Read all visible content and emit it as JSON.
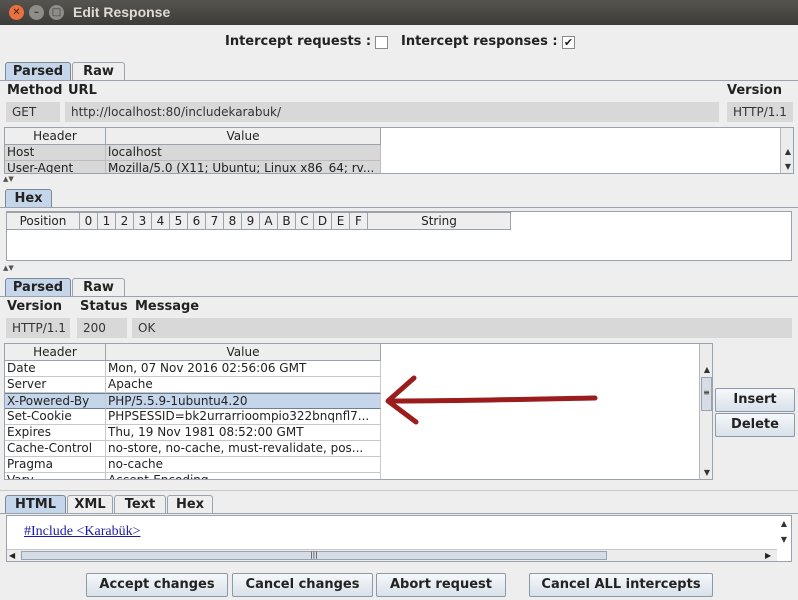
{
  "window": {
    "title": "Edit Response",
    "close": "✕",
    "minimize": "–",
    "maximize": "□"
  },
  "intercept": {
    "requests_label": "Intercept requests :",
    "requests_checked": false,
    "responses_label": "Intercept responses :",
    "responses_checked": true,
    "check_glyph": "✔"
  },
  "request": {
    "tabs": [
      "Parsed",
      "Raw"
    ],
    "method_label": "Method",
    "url_label": "URL",
    "version_label": "Version",
    "method": "GET",
    "url": "http://localhost:80/includekarabuk/",
    "version": "HTTP/1.1",
    "header_col": "Header",
    "value_col": "Value",
    "headers": [
      {
        "name": "Host",
        "value": "localhost"
      },
      {
        "name": "User-Agent",
        "value": "Mozilla/5.0 (X11; Ubuntu; Linux x86_64; rv..."
      }
    ]
  },
  "hex": {
    "tab": "Hex",
    "position_col": "Position",
    "cols": [
      "0",
      "1",
      "2",
      "3",
      "4",
      "5",
      "6",
      "7",
      "8",
      "9",
      "A",
      "B",
      "C",
      "D",
      "E",
      "F"
    ],
    "string_col": "String"
  },
  "response": {
    "tabs": [
      "Parsed",
      "Raw"
    ],
    "version_label": "Version",
    "status_label": "Status",
    "message_label": "Message",
    "version": "HTTP/1.1",
    "status": "200",
    "message": "OK",
    "header_col": "Header",
    "value_col": "Value",
    "headers": [
      {
        "name": "Date",
        "value": "Mon, 07 Nov 2016 02:56:06 GMT"
      },
      {
        "name": "Server",
        "value": "Apache"
      },
      {
        "name": "X-Powered-By",
        "value": "PHP/5.5.9-1ubuntu4.20"
      },
      {
        "name": "Set-Cookie",
        "value": "PHPSESSID=bk2urrarrioompio322bnqnfl7..."
      },
      {
        "name": "Expires",
        "value": "Thu, 19 Nov 1981 08:52:00 GMT"
      },
      {
        "name": "Cache-Control",
        "value": "no-store, no-cache, must-revalidate, pos..."
      },
      {
        "name": "Pragma",
        "value": "no-cache"
      },
      {
        "name": "Vary",
        "value": "Accept-Encoding"
      }
    ],
    "selected_row": 2,
    "insert_label": "Insert",
    "delete_label": "Delete"
  },
  "body_view": {
    "tabs": [
      "HTML",
      "XML",
      "Text",
      "Hex"
    ],
    "content": "#Include <Karabük> "
  },
  "footer": {
    "accept": "Accept changes",
    "cancel": "Cancel changes",
    "abort": "Abort request",
    "cancel_all": "Cancel ALL intercepts"
  },
  "colors": {
    "selection": "#c6d6ea",
    "annotation_arrow": "#9b1c1c",
    "link": "#1a1aa8"
  }
}
